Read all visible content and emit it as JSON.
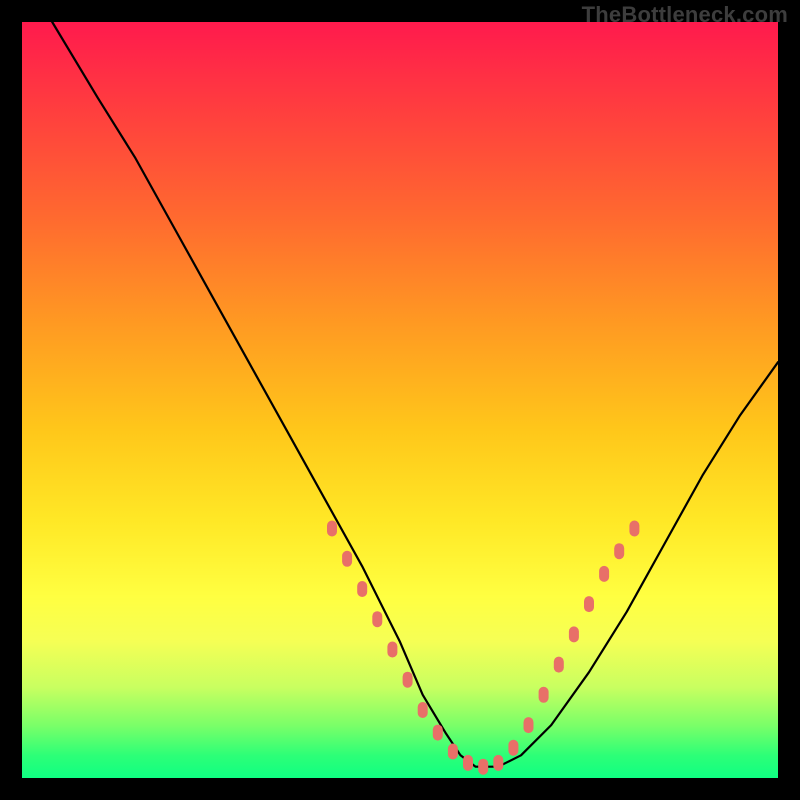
{
  "watermark": "TheBottleneck.com",
  "palette": {
    "page_bg": "#000000",
    "gradient_top": "#ff1a4d",
    "gradient_bottom": "#0fff82",
    "curve": "#000000",
    "dots": "#e87068"
  },
  "chart_data": {
    "type": "line",
    "title": "",
    "xlabel": "",
    "ylabel": "",
    "xlim": [
      0,
      100
    ],
    "ylim": [
      0,
      100
    ],
    "grid": false,
    "legend": false,
    "series": [
      {
        "name": "curve",
        "x": [
          4,
          10,
          15,
          20,
          25,
          30,
          35,
          40,
          45,
          50,
          53,
          56,
          58,
          60,
          63,
          66,
          70,
          75,
          80,
          85,
          90,
          95,
          100
        ],
        "y": [
          100,
          90,
          82,
          73,
          64,
          55,
          46,
          37,
          28,
          18,
          11,
          6,
          3,
          1.5,
          1.5,
          3,
          7,
          14,
          22,
          31,
          40,
          48,
          55
        ]
      }
    ],
    "points": [
      {
        "x": 41,
        "y": 33
      },
      {
        "x": 43,
        "y": 29
      },
      {
        "x": 45,
        "y": 25
      },
      {
        "x": 47,
        "y": 21
      },
      {
        "x": 49,
        "y": 17
      },
      {
        "x": 51,
        "y": 13
      },
      {
        "x": 53,
        "y": 9
      },
      {
        "x": 55,
        "y": 6
      },
      {
        "x": 57,
        "y": 3.5
      },
      {
        "x": 59,
        "y": 2
      },
      {
        "x": 61,
        "y": 1.5
      },
      {
        "x": 63,
        "y": 2
      },
      {
        "x": 65,
        "y": 4
      },
      {
        "x": 67,
        "y": 7
      },
      {
        "x": 69,
        "y": 11
      },
      {
        "x": 71,
        "y": 15
      },
      {
        "x": 73,
        "y": 19
      },
      {
        "x": 75,
        "y": 23
      },
      {
        "x": 77,
        "y": 27
      },
      {
        "x": 79,
        "y": 30
      },
      {
        "x": 81,
        "y": 33
      }
    ]
  }
}
